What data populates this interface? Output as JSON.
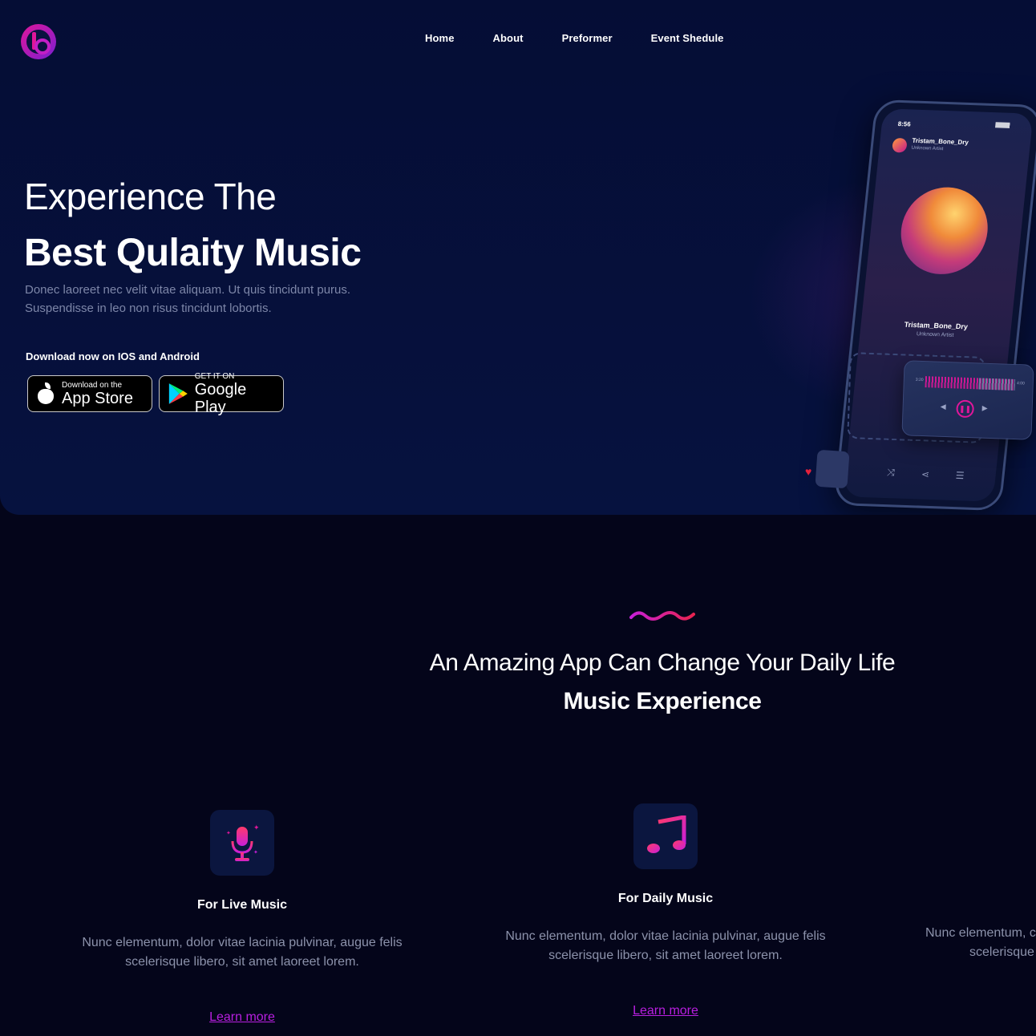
{
  "nav": {
    "items": [
      "Home",
      "About",
      "Preformer",
      "Event Shedule"
    ]
  },
  "hero": {
    "title_line1": "Experience The",
    "title_line2": "Best Qulaity Music",
    "description": "Donec laoreet nec velit vitae aliquam. Ut quis tincidunt purus. Suspendisse in leo non risus tincidunt lobortis.",
    "download_label": "Download now on IOS and Android",
    "app_store": {
      "small": "Download on the",
      "big": "App Store"
    },
    "google_play": {
      "small": "GET IT ON",
      "big": "Google Play"
    }
  },
  "phone": {
    "time": "8:56",
    "song_title": "Tristam_Bone_Dry",
    "artist": "Unknown Artist",
    "player_start": "3:20",
    "player_end": "4:00"
  },
  "section": {
    "title_line1": "An Amazing App Can Change Your Daily Life",
    "title_line2": "Music Experience"
  },
  "features": [
    {
      "icon": "microphone-icon",
      "title": "For Live Music",
      "description": "Nunc elementum, dolor vitae lacinia pulvinar, augue felis scelerisque libero, sit amet laoreet lorem.",
      "link": "Learn more"
    },
    {
      "icon": "music-notes-icon",
      "title": "For Daily Music",
      "description": "Nunc elementum, dolor vitae lacinia pulvinar, augue felis scelerisque libero, sit amet laoreet lorem.",
      "link": "Learn more"
    },
    {
      "description_line1": "Nunc elementum, c",
      "description_line2": "scelerisque"
    }
  ],
  "colors": {
    "accent": "#e0169a",
    "link": "#b81fe0",
    "hero_bg": "#06123f",
    "page_bg": "#04051a"
  }
}
